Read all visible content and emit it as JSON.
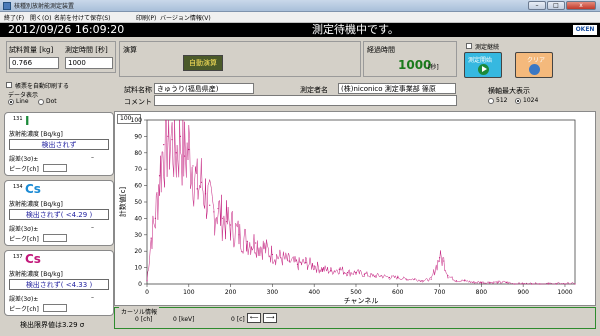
{
  "window": {
    "title": "核種別放射能測定装置",
    "min": "–",
    "max": "□",
    "close": "x"
  },
  "menu": [
    "終了(F)",
    "開く(O)",
    "名前を付けて保存(S)",
    "印刷(P)",
    "バージョン情報(V)"
  ],
  "status": {
    "datetime": "2012/09/26 16:09:20",
    "message": "測定待機中です。",
    "logo": "OKEN"
  },
  "sample": {
    "weight_label": "試料質量 [kg]",
    "weight_value": "0.766",
    "time_label": "測定時間 [秒]",
    "time_value": "1000"
  },
  "calc": {
    "label": "演算",
    "button": "自動演算"
  },
  "elapsed": {
    "label": "経過時間",
    "value": "1000",
    "unit": "[秒]"
  },
  "continuous": {
    "label": "測定継続"
  },
  "start_button": "測定開始",
  "clear_button": "クリア",
  "options": {
    "auto_print": "帳票を自動印刷する",
    "data_display": "データ表示",
    "line": "Line",
    "dot": "Dot"
  },
  "sample_info": {
    "name_label": "試料名称",
    "name_value": "きゅうり(福島県産)",
    "operator_label": "測定者名",
    "operator_value": "(株)niconico 測定事業部 篠原",
    "comment_label": "コメント"
  },
  "axis_max": {
    "label": "横軸最大表示",
    "opt1": "512",
    "opt2": "1024"
  },
  "isotopes": [
    {
      "mass": "131",
      "symbol": "I",
      "conc_label": "放射能濃度 [Bq/kg]",
      "result": "検出されず",
      "error_label": "誤差(3σ)±",
      "error_value": "–",
      "peak_label": "ピーク[ch]"
    },
    {
      "mass": "134",
      "symbol": "Cs",
      "conc_label": "放射能濃度 [Bq/kg]",
      "result": "検出されず( <4.29 )",
      "error_label": "誤差(3σ)±",
      "error_value": "–",
      "peak_label": "ピーク[ch]"
    },
    {
      "mass": "137",
      "symbol": "Cs",
      "conc_label": "放射能濃度 [Bq/kg]",
      "result": "検出されず( <4.33 )",
      "error_label": "誤差(3σ)±",
      "error_value": "–",
      "peak_label": "ピーク[ch]"
    }
  ],
  "detection_limit": "検出限界値は3.29 σ",
  "cursor": {
    "title": "カーソル情報",
    "ch": "0 [ch]",
    "kev": "0 [keV]",
    "c": "0 [c]",
    "left": "⟵",
    "right": "⟶"
  },
  "chart_data": {
    "type": "line",
    "title": "",
    "xlabel": "チャンネル",
    "ylabel": "計数値[c]",
    "xlim": [
      0,
      1024
    ],
    "ylim": [
      0,
      100
    ],
    "y_dropdown": "100",
    "color": "#c2187a",
    "x": [
      0,
      10,
      20,
      30,
      40,
      50,
      60,
      70,
      80,
      90,
      100,
      110,
      120,
      130,
      140,
      150,
      160,
      170,
      180,
      190,
      200,
      220,
      240,
      260,
      280,
      300,
      320,
      340,
      360,
      380,
      400,
      420,
      440,
      460,
      480,
      500,
      520,
      540,
      560,
      580,
      600,
      620,
      640,
      660,
      680,
      700,
      710,
      720,
      740,
      760,
      780,
      800,
      820,
      840,
      860,
      880,
      900,
      920,
      940,
      960,
      980,
      1000,
      1024
    ],
    "values": [
      2,
      28,
      40,
      66,
      85,
      90,
      88,
      80,
      90,
      78,
      82,
      72,
      58,
      62,
      55,
      48,
      44,
      46,
      40,
      38,
      36,
      30,
      26,
      25,
      22,
      18,
      16,
      14,
      12,
      13,
      11,
      9,
      8,
      9,
      7,
      7,
      6,
      5,
      5,
      4,
      4,
      3,
      3,
      2,
      3,
      16,
      14,
      5,
      2,
      2,
      1,
      1,
      1,
      1,
      1,
      0,
      0,
      0,
      0,
      0,
      0,
      0,
      0
    ],
    "xticks": [
      "0",
      "100",
      "200",
      "300",
      "400",
      "500",
      "600",
      "700",
      "800",
      "900",
      "1000"
    ],
    "yticks": [
      "0",
      "10",
      "20",
      "30",
      "40",
      "50",
      "60",
      "70",
      "80",
      "90",
      "100"
    ]
  }
}
